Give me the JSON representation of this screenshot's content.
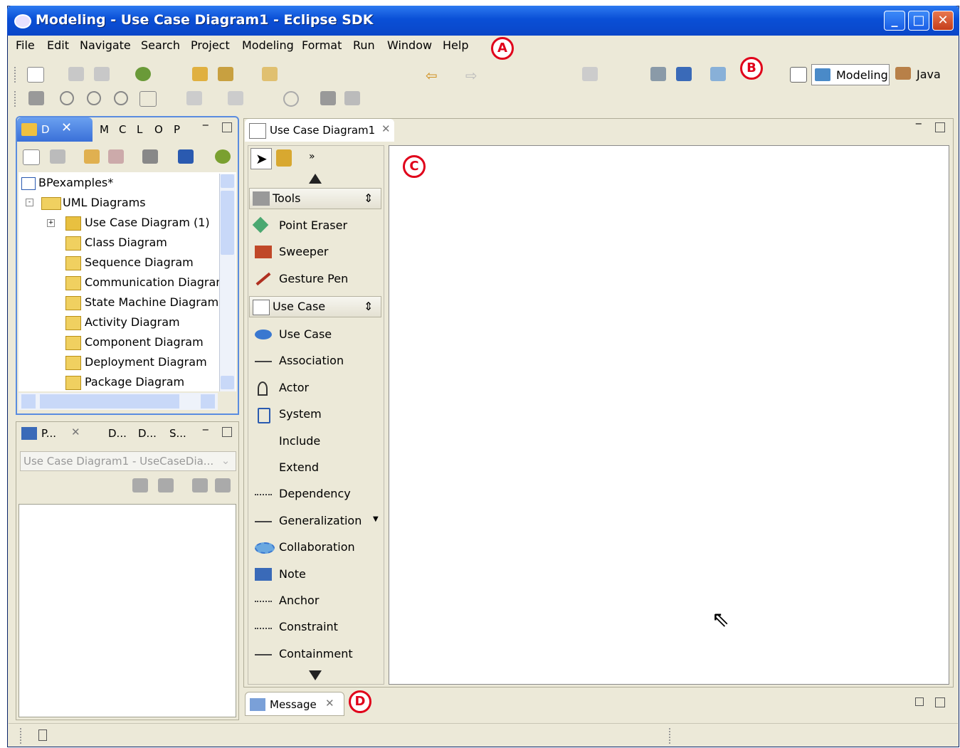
{
  "window": {
    "title": "Modeling - Use Case Diagram1 - Eclipse SDK"
  },
  "menu": [
    "File",
    "Edit",
    "Navigate",
    "Search",
    "Project",
    "Modeling",
    "Format",
    "Run",
    "Window",
    "Help"
  ],
  "markers": {
    "a": "A",
    "b": "B",
    "c": "C",
    "d": "D"
  },
  "perspectives": {
    "modeling": "Modeling",
    "java": "Java"
  },
  "explorer": {
    "tabs": [
      "D",
      "M",
      "C",
      "L",
      "O",
      "P"
    ],
    "root": "BPexamples*",
    "folder": "UML Diagrams",
    "items": [
      "Use Case Diagram (1)",
      "Class Diagram",
      "Sequence Diagram",
      "Communication Diagram",
      "State Machine Diagram",
      "Activity Diagram",
      "Component Diagram",
      "Deployment Diagram",
      "Package Diagram"
    ]
  },
  "properties": {
    "tabs": [
      "P...",
      "D...",
      "D...",
      "S..."
    ],
    "combo_value": "Use Case Diagram1 - UseCaseDia..."
  },
  "editor": {
    "tab": "Use Case Diagram1"
  },
  "palette": {
    "tools_header": "Tools",
    "tools": [
      "Point Eraser",
      "Sweeper",
      "Gesture Pen"
    ],
    "usecase_header": "Use Case",
    "usecase_items": [
      "Use Case",
      "Association",
      "Actor",
      "System",
      "Include",
      "Extend",
      "Dependency",
      "Generalization",
      "Collaboration",
      "Note",
      "Anchor",
      "Constraint",
      "Containment"
    ]
  },
  "message": {
    "tab": "Message"
  }
}
